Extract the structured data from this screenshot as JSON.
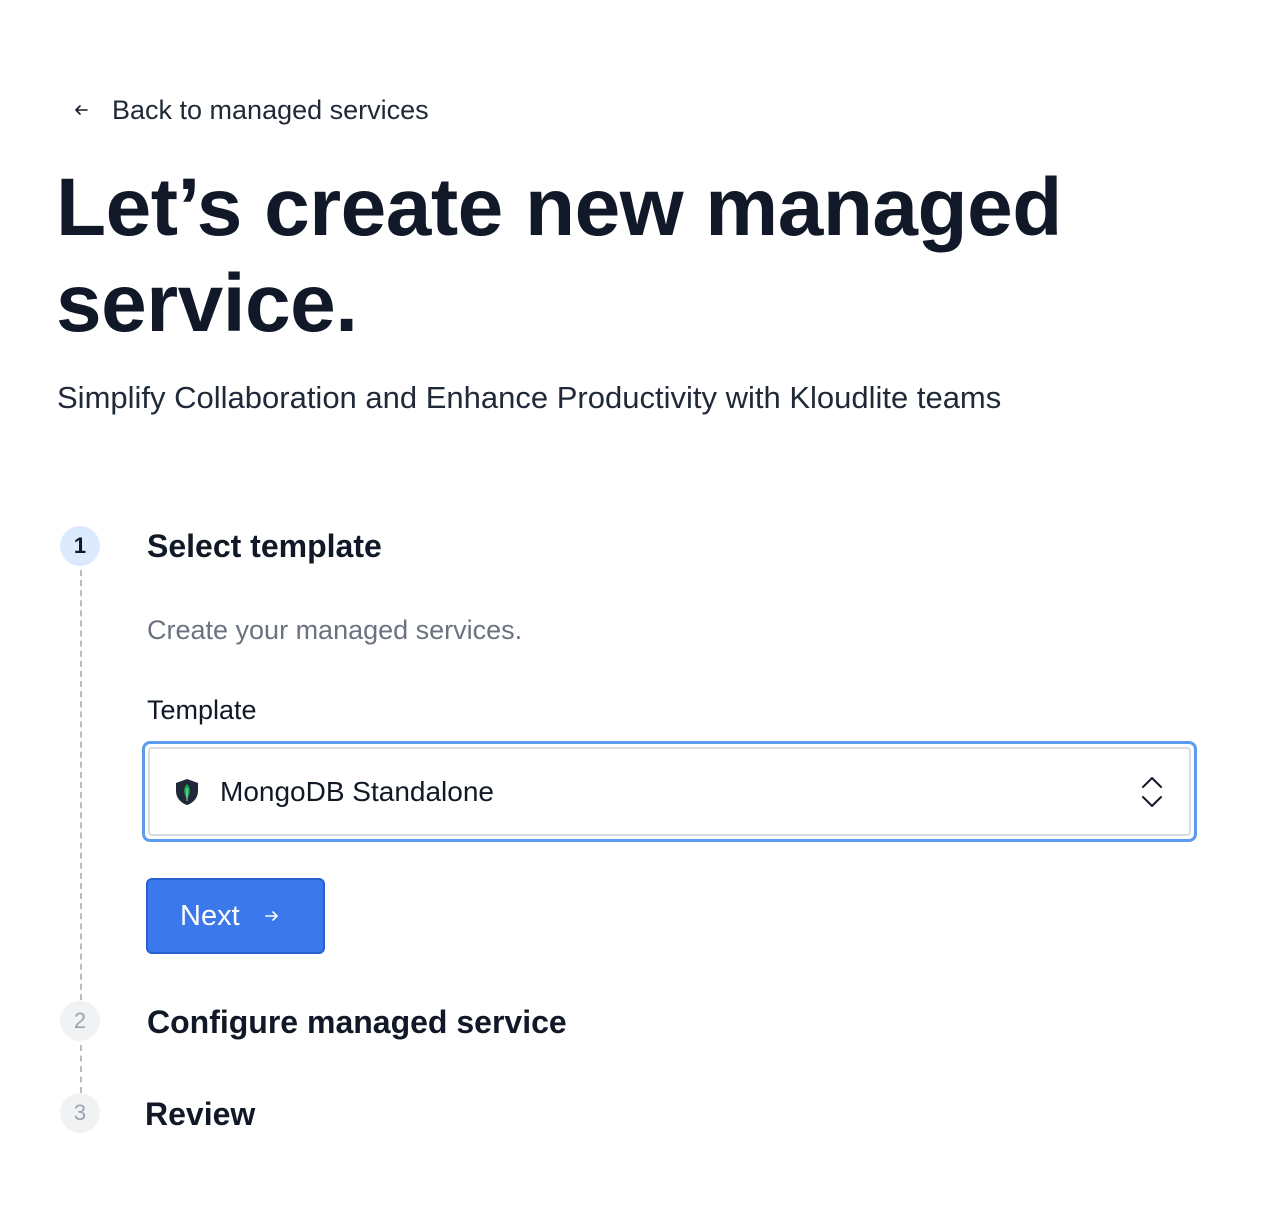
{
  "back_link": {
    "label": "Back to managed services",
    "icon": "arrow-left-icon"
  },
  "header": {
    "title": "Let’s create new managed service.",
    "subtitle": "Simplify Collaboration and Enhance Productivity with Kloudlite teams"
  },
  "steps": [
    {
      "number": "1",
      "title": "Select template",
      "status": "active",
      "description": "Create your managed services."
    },
    {
      "number": "2",
      "title": "Configure managed service",
      "status": "inactive"
    },
    {
      "number": "3",
      "title": "Review",
      "status": "inactive"
    }
  ],
  "form": {
    "template_label": "Template",
    "template_value": "MongoDB Standalone",
    "template_icon": "mongodb-leaf-icon",
    "select_icon": "chevron-up-down-icon"
  },
  "actions": {
    "next_label": "Next",
    "next_icon": "arrow-right-icon"
  },
  "colors": {
    "primary": "#3b78ec",
    "focus_ring": "#5b9bf0",
    "active_step_bg": "#dbeafe",
    "mongodb_green": "#13aa52"
  }
}
